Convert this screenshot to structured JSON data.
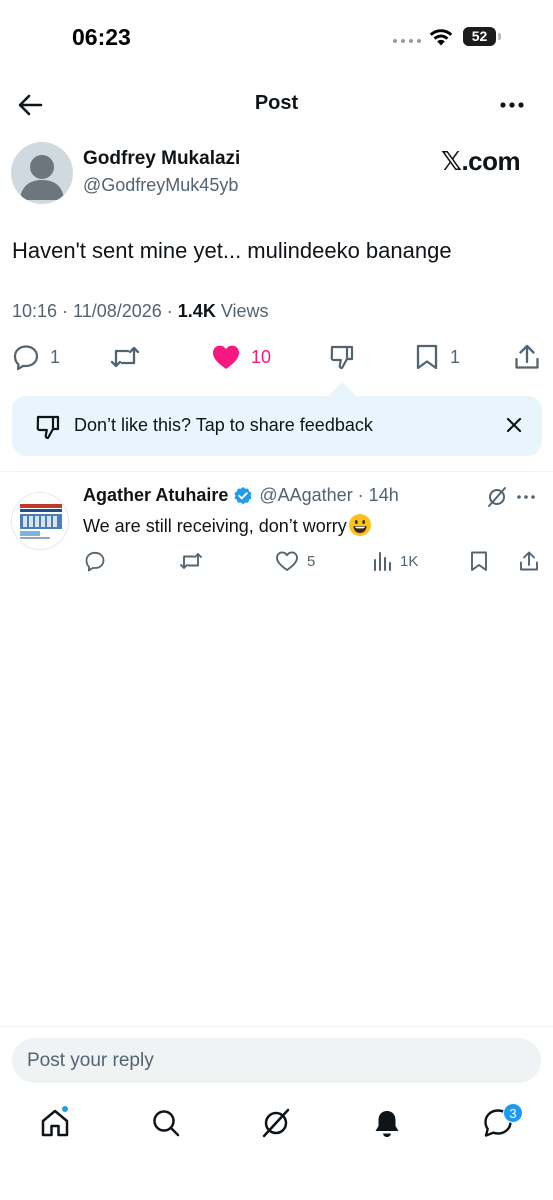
{
  "status_bar": {
    "time": "06:23",
    "battery": "52",
    "battery_level_percent": 52
  },
  "header": {
    "title": "Post",
    "back_icon": "arrow-left-icon",
    "more_icon": "more-horizontal-icon"
  },
  "post": {
    "author_name": "Godfrey Mukalazi",
    "author_handle": "@GodfreyMuk45yb",
    "source_label": "𝕏.com",
    "text": "Haven't sent mine yet... mulindeeko banange",
    "timestamp": "10:16 · 11/08/2026 · ",
    "views_count": "1.4K",
    "views_label": " Views",
    "actions": {
      "replies": "1",
      "likes": "10",
      "bookmarks": "1"
    },
    "like_color": "#f91880"
  },
  "feedback": {
    "text": "Don’t like this? Tap to share feedback",
    "background": "#e8f5fd"
  },
  "reply": {
    "author_name": "Agather Atuhaire",
    "author_handle": "@AAgather · 14h",
    "text": "We are still receiving, don’t worry",
    "likes": "5",
    "views": "1K",
    "verified_color": "#1d9bf0"
  },
  "composer": {
    "placeholder": "Post your reply"
  },
  "tabbar": {
    "items": [
      "home-icon",
      "search-icon",
      "grok-icon",
      "notifications-icon",
      "messages-icon"
    ],
    "messages_badge": "3",
    "accent": "#1d9bf0"
  }
}
